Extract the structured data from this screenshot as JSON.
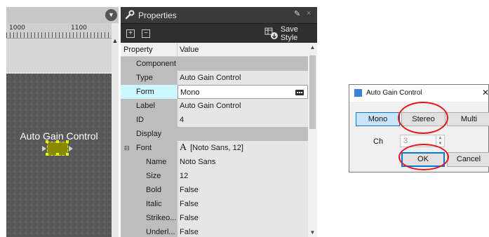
{
  "canvas": {
    "ruler_labels": [
      "1000",
      "1100"
    ],
    "component_label": "Auto Gain Control"
  },
  "properties": {
    "title": "Properties",
    "toolbar": {
      "expand_all": "+",
      "collapse_all": "−",
      "save_style": "Save Style"
    },
    "columns": {
      "property": "Property",
      "value": "Value"
    },
    "rows": [
      {
        "label": "Component",
        "value": ""
      },
      {
        "label": "Type",
        "value": "Auto Gain Control"
      },
      {
        "label": "Form",
        "value": "Mono"
      },
      {
        "label": "Label",
        "value": "Auto Gain Control"
      },
      {
        "label": "ID",
        "value": "4"
      },
      {
        "label": "Display",
        "value": ""
      },
      {
        "label": "Font",
        "value": "[Noto Sans, 12]",
        "glyph": "A"
      },
      {
        "label": "Name",
        "value": "Noto Sans"
      },
      {
        "label": "Size",
        "value": "12"
      },
      {
        "label": "Bold",
        "value": "False"
      },
      {
        "label": "Italic",
        "value": "False"
      },
      {
        "label": "Strikeo...",
        "value": "False"
      },
      {
        "label": "Underl...",
        "value": "False"
      }
    ]
  },
  "dialog": {
    "title": "Auto Gain Control",
    "close": "✕",
    "modes": [
      "Mono",
      "Stereo",
      "Multi"
    ],
    "selected_mode": "Mono",
    "ch_label": "Ch",
    "ch_value": "3",
    "ok": "OK",
    "cancel": "Cancel"
  },
  "colors": {
    "annotation": "#e8141c",
    "selection": "#cdf7ff",
    "accent": "#0078d7"
  }
}
